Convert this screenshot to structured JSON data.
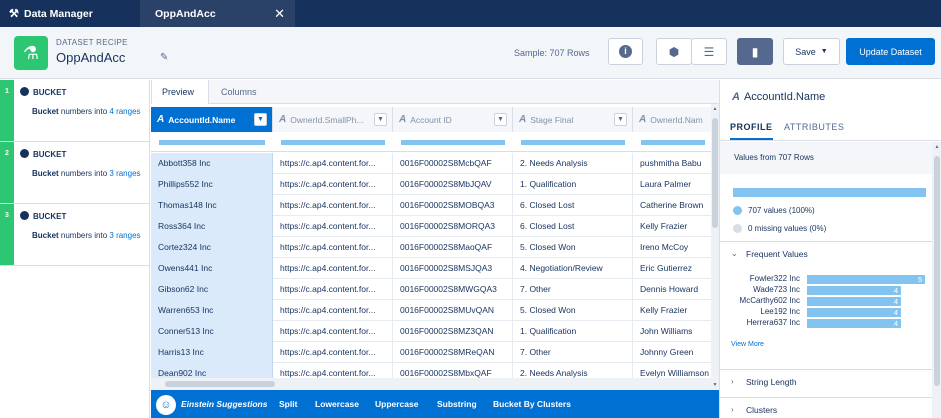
{
  "tabs": [
    {
      "label": "Data Manager"
    },
    {
      "label": "OppAndAcc"
    }
  ],
  "header": {
    "subtitle": "DATASET RECIPE",
    "title": "OppAndAcc",
    "sample": "Sample: 707 Rows",
    "save_label": "Save",
    "update_label": "Update Dataset"
  },
  "steps": [
    {
      "num": "1",
      "kind": "BUCKET",
      "pre": "Bucket",
      "mid": " numbers into ",
      "link": "4 ranges"
    },
    {
      "num": "2",
      "kind": "BUCKET",
      "pre": "Bucket",
      "mid": " numbers into ",
      "link": "3 ranges"
    },
    {
      "num": "3",
      "kind": "BUCKET",
      "pre": "Bucket",
      "mid": " numbers into ",
      "link": "3 ranges"
    }
  ],
  "view_tabs": [
    {
      "label": "Preview"
    },
    {
      "label": "Columns"
    }
  ],
  "columns": [
    {
      "label": "AccountId.Name"
    },
    {
      "label": "OwnerId.SmallPh..."
    },
    {
      "label": "Account ID"
    },
    {
      "label": "Stage Final"
    },
    {
      "label": "OwnerId.Nam"
    }
  ],
  "rows": [
    [
      "Abbott358 Inc",
      "https://c.ap4.content.for...",
      "0016F00002S8McbQAF",
      "2. Needs Analysis",
      "pushmitha Babu"
    ],
    [
      "Phillips552 Inc",
      "https://c.ap4.content.for...",
      "0016F00002S8MbJQAV",
      "1. Qualification",
      "Laura Palmer"
    ],
    [
      "Thomas148 Inc",
      "https://c.ap4.content.for...",
      "0016F00002S8MOBQA3",
      "6. Closed Lost",
      "Catherine Brown"
    ],
    [
      "Ross364 Inc",
      "https://c.ap4.content.for...",
      "0016F00002S8MORQA3",
      "6. Closed Lost",
      "Kelly Frazier"
    ],
    [
      "Cortez324 Inc",
      "https://c.ap4.content.for...",
      "0016F00002S8MaoQAF",
      "5. Closed Won",
      "Ireno McCoy"
    ],
    [
      "Owens441 Inc",
      "https://c.ap4.content.for...",
      "0016F00002S8MSJQA3",
      "4. Negotiation/Review",
      "Eric Gutierrez"
    ],
    [
      "Gibson62 Inc",
      "https://c.ap4.content.for...",
      "0016F00002S8MWGQA3",
      "7. Other",
      "Dennis Howard"
    ],
    [
      "Warren653 Inc",
      "https://c.ap4.content.for...",
      "0016F00002S8MUvQAN",
      "5. Closed Won",
      "Kelly Frazier"
    ],
    [
      "Conner513 Inc",
      "https://c.ap4.content.for...",
      "0016F00002S8MZ3QAN",
      "1. Qualification",
      "John Williams"
    ],
    [
      "Harris13 Inc",
      "https://c.ap4.content.for...",
      "0016F00002S8MReQAN",
      "7. Other",
      "Johnny Green"
    ],
    [
      "Dean902 Inc",
      "https://c.ap4.content.for...",
      "0016F00002S8MbxQAF",
      "2. Needs Analysis",
      "Evelyn Williamson"
    ]
  ],
  "suggestions": {
    "label": "Einstein Suggestions",
    "items": [
      "Split",
      "Lowercase",
      "Uppercase",
      "Substring",
      "Bucket By Clusters"
    ]
  },
  "profile": {
    "title": "AccountId.Name",
    "tabs": [
      "PROFILE",
      "ATTRIBUTES"
    ],
    "values_from": "Values from 707 Rows",
    "valid": "707 values (100%)",
    "missing": "0 missing values (0%)",
    "frequent_title": "Frequent Values",
    "frequent": [
      {
        "label": "Fowler322 Inc",
        "count": "5",
        "frac": 1.0
      },
      {
        "label": "Wade723 Inc",
        "count": "4",
        "frac": 0.8
      },
      {
        "label": "McCarthy602 Inc",
        "count": "4",
        "frac": 0.8
      },
      {
        "label": "Lee192 Inc",
        "count": "4",
        "frac": 0.8
      },
      {
        "label": "Herrera637 Inc",
        "count": "4",
        "frac": 0.8
      }
    ],
    "view_more": "View More",
    "sections": [
      "String Length",
      "Clusters"
    ],
    "colors": {
      "bar": "#83c3f0",
      "valid_dot": "#83c3f0",
      "missing_dot": "#d8dde6"
    }
  }
}
